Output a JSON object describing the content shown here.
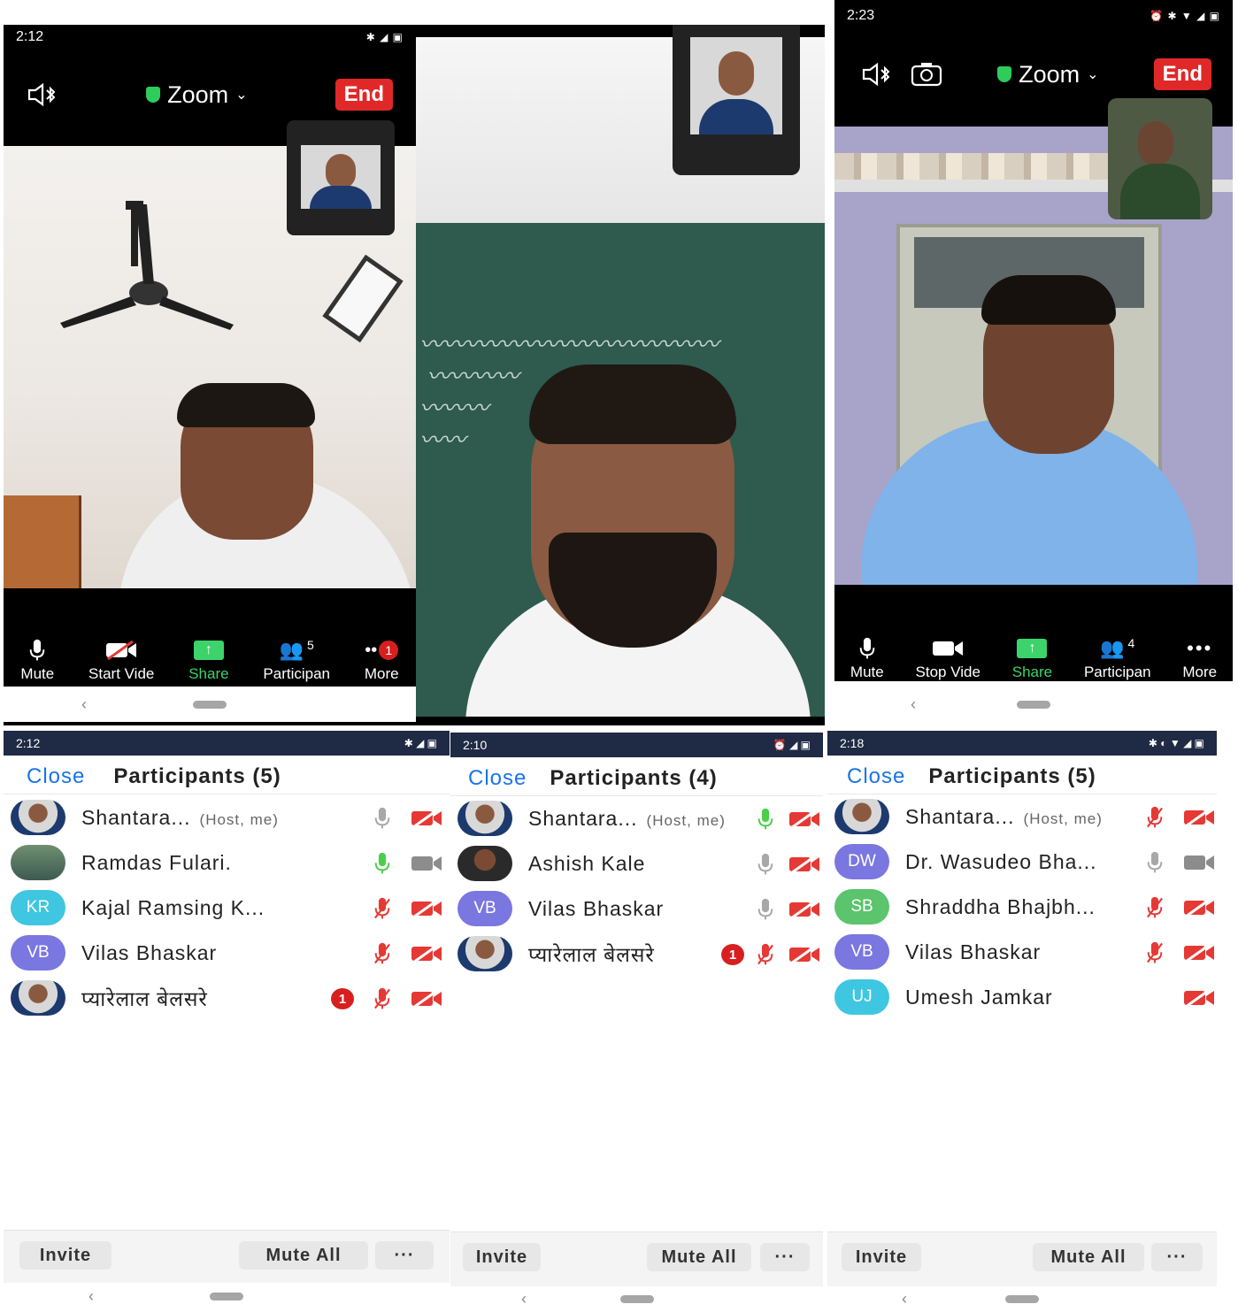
{
  "screen1": {
    "status_time": "2:12",
    "app_title": "Zoom",
    "end_label": "End",
    "toolbar": [
      {
        "label": "Mute",
        "icon": "mic-icon"
      },
      {
        "label": "Start Vide",
        "icon": "video-off-icon"
      },
      {
        "label": "Share",
        "icon": "share-icon"
      },
      {
        "label": "Participan",
        "icon": "participants-icon",
        "count": "5"
      },
      {
        "label": "More",
        "icon": "more-icon",
        "badge": "1"
      }
    ]
  },
  "screen3": {
    "status_time": "2:23",
    "app_title": "Zoom",
    "end_label": "End",
    "toolbar": [
      {
        "label": "Mute",
        "icon": "mic-icon"
      },
      {
        "label": "Stop Vide",
        "icon": "video-icon"
      },
      {
        "label": "Share",
        "icon": "share-icon"
      },
      {
        "label": "Participan",
        "icon": "participants-icon",
        "count": "4"
      },
      {
        "label": "More",
        "icon": "more-icon"
      }
    ]
  },
  "list1": {
    "status_time": "2:12",
    "close_label": "Close",
    "title": "Participants (5)",
    "participants": [
      {
        "name": "Shantara...",
        "tag": "(Host, me)",
        "avatar": "photo",
        "mic": "on-grey",
        "cam": "off"
      },
      {
        "name": "Ramdas  Fulari.",
        "tag": "",
        "avatar": "photo-landscape",
        "mic": "on-green",
        "cam": "on"
      },
      {
        "name": "Kajal Ramsing K...",
        "tag": "",
        "initials": "KR",
        "color": "#3fc6e0",
        "mic": "off",
        "cam": "off"
      },
      {
        "name": "Vilas Bhaskar",
        "tag": "",
        "initials": "VB",
        "color": "#7a77e0",
        "mic": "off",
        "cam": "off"
      },
      {
        "name": "प्यारेलाल बेलसरे",
        "tag": "",
        "avatar": "photo",
        "badge": "1",
        "mic": "off",
        "cam": "off"
      }
    ],
    "invite_label": "Invite",
    "mute_all_label": "Mute All",
    "more_label": "···"
  },
  "list2": {
    "status_time": "2:10",
    "close_label": "Close",
    "title": "Participants (4)",
    "participants": [
      {
        "name": "Shantara...",
        "tag": "(Host, me)",
        "avatar": "photo",
        "mic": "on-green",
        "cam": "off"
      },
      {
        "name": "Ashish Kale",
        "tag": "",
        "avatar": "photo-dark",
        "mic": "on-grey",
        "cam": "off"
      },
      {
        "name": "Vilas Bhaskar",
        "tag": "",
        "initials": "VB",
        "color": "#7a77e0",
        "mic": "on-grey",
        "cam": "off"
      },
      {
        "name": "प्यारेलाल बेलसरे",
        "tag": "",
        "avatar": "photo",
        "badge": "1",
        "mic": "off",
        "cam": "off"
      }
    ],
    "invite_label": "Invite",
    "mute_all_label": "Mute All",
    "more_label": "···"
  },
  "list3": {
    "status_time": "2:18",
    "close_label": "Close",
    "title": "Participants (5)",
    "participants": [
      {
        "name": "Shantara...",
        "tag": "(Host, me)",
        "avatar": "photo",
        "mic": "off",
        "cam": "off"
      },
      {
        "name": "Dr. Wasudeo Bha...",
        "tag": "",
        "initials": "DW",
        "color": "#7a77e0",
        "mic": "on-grey",
        "cam": "on"
      },
      {
        "name": "Shraddha Bhajbh...",
        "tag": "",
        "initials": "SB",
        "color": "#5bc46d",
        "mic": "off",
        "cam": "off"
      },
      {
        "name": "Vilas Bhaskar",
        "tag": "",
        "initials": "VB",
        "color": "#7a77e0",
        "mic": "off",
        "cam": "off"
      },
      {
        "name": "Umesh Jamkar",
        "tag": "",
        "initials": "UJ",
        "color": "#3fc6e0",
        "mic": "none",
        "cam": "off"
      }
    ],
    "invite_label": "Invite",
    "mute_all_label": "Mute All",
    "more_label": "···"
  },
  "colors": {
    "accent": "#1a73e8",
    "end": "#e02828",
    "share": "#3dd36b",
    "muted": "#e53935"
  }
}
